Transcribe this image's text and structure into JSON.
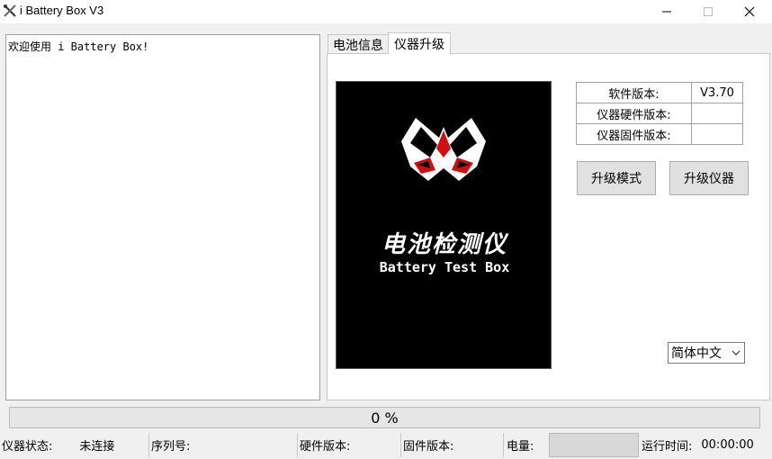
{
  "window": {
    "title": "i Battery Box V3"
  },
  "log": {
    "text": "欢迎使用 i Battery Box!"
  },
  "tabs": [
    {
      "label": "电池信息",
      "active": false
    },
    {
      "label": "仪器升级",
      "active": true
    }
  ],
  "splash": {
    "title_cn": "电池检测仪",
    "title_en": "Battery Test Box"
  },
  "info_table": [
    {
      "label": "软件版本:",
      "value": "V3.70"
    },
    {
      "label": "仪器硬件版本:",
      "value": ""
    },
    {
      "label": "仪器固件版本:",
      "value": ""
    }
  ],
  "buttons": {
    "upgrade_mode": "升级模式",
    "upgrade_device": "升级仪器"
  },
  "language": {
    "selected": "简体中文"
  },
  "progress": {
    "value": 0,
    "text": "0 %"
  },
  "status": {
    "device_state_label": "仪器状态:",
    "device_state_value": "未连接",
    "serial_label": "序列号:",
    "hw_version_label": "硬件版本:",
    "fw_version_label": "固件版本:",
    "battery_label": "电量:",
    "runtime_label": "运行时间:",
    "runtime_value": "00:00:00"
  },
  "colors": {
    "progress_fill": "#06b025",
    "splash_bg": "#000000",
    "logo_accent": "#d01010"
  },
  "icons": [
    "app-tools-icon",
    "minimize-icon",
    "maximize-icon",
    "close-icon",
    "chevron-down-icon"
  ]
}
